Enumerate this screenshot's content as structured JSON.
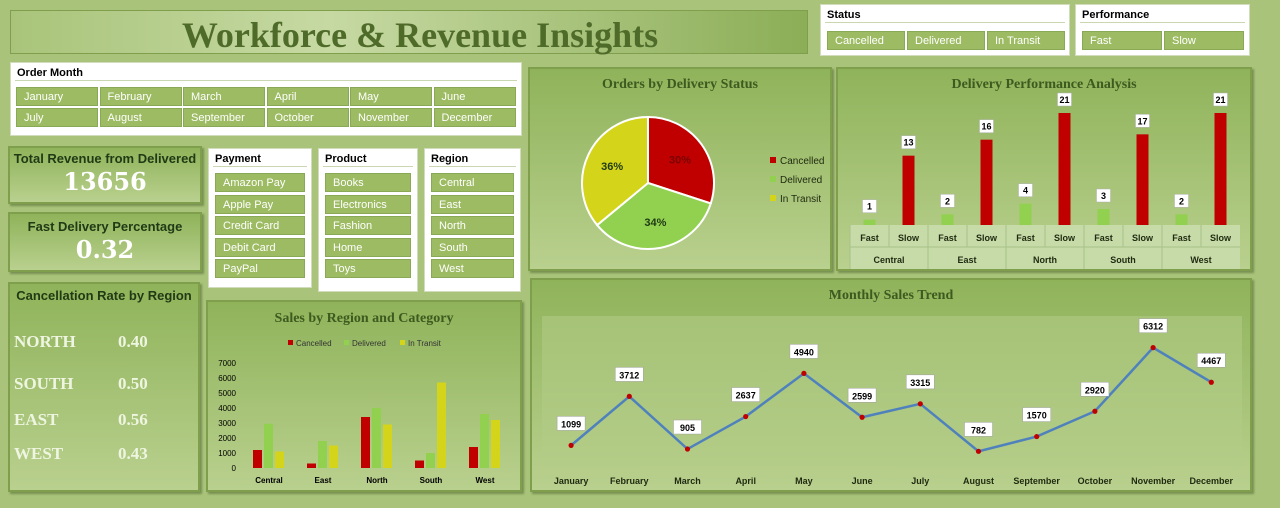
{
  "header": {
    "title": "Workforce & Revenue Insights"
  },
  "status_slicer": {
    "title": "Status",
    "items": [
      "Cancelled",
      "Delivered",
      "In Transit"
    ]
  },
  "performance_slicer": {
    "title": "Performance",
    "items": [
      "Fast",
      "Slow"
    ]
  },
  "order_month_slicer": {
    "title": "Order Month",
    "items": [
      "January",
      "February",
      "March",
      "April",
      "May",
      "June",
      "July",
      "August",
      "September",
      "October",
      "November",
      "December"
    ]
  },
  "kpis": {
    "revenue": {
      "label": "Total Revenue from Delivered",
      "value": "13656"
    },
    "fast_delivery": {
      "label": "Fast Delivery Percentage",
      "value": "0.32"
    },
    "cancellation": {
      "label": "Cancellation Rate by Region",
      "rows": [
        {
          "region": "NORTH",
          "value": "0.40"
        },
        {
          "region": "SOUTH",
          "value": "0.50"
        },
        {
          "region": "EAST",
          "value": "0.56"
        },
        {
          "region": "WEST",
          "value": "0.43"
        }
      ]
    }
  },
  "payment_slicer": {
    "title": "Payment",
    "items": [
      "Amazon Pay",
      "Apple Pay",
      "Credit Card",
      "Debit Card",
      "PayPal"
    ]
  },
  "product_slicer": {
    "title": "Product",
    "items": [
      "Books",
      "Electronics",
      "Fashion",
      "Home",
      "Toys"
    ]
  },
  "region_slicer": {
    "title": "Region",
    "items": [
      "Central",
      "East",
      "North",
      "South",
      "West"
    ]
  },
  "colors": {
    "cancelled": "#c00000",
    "delivered": "#92d050",
    "in_transit": "#d4d41a",
    "line": "#4f81bd",
    "marker": "#c00000"
  },
  "chart_data": [
    {
      "type": "pie",
      "title": "Orders by Delivery Status",
      "labels": [
        "Cancelled",
        "Delivered",
        "In Transit"
      ],
      "values": [
        30,
        34,
        36
      ],
      "value_labels": [
        "30%",
        "34%",
        "36%"
      ],
      "legend": "right"
    },
    {
      "type": "bar",
      "title": "Delivery Performance Analysis",
      "groups": [
        "Central",
        "East",
        "North",
        "South",
        "West"
      ],
      "categories": [
        "Fast",
        "Slow"
      ],
      "values": [
        [
          1,
          13
        ],
        [
          2,
          16
        ],
        [
          4,
          21
        ],
        [
          3,
          17
        ],
        [
          2,
          21
        ]
      ],
      "labels": [
        [
          "1",
          "13"
        ],
        [
          "2",
          "16"
        ],
        [
          "4",
          "21"
        ],
        [
          "3",
          "17"
        ],
        [
          "2",
          "21"
        ]
      ]
    },
    {
      "type": "bar",
      "title": "Sales by Region and Category",
      "categories": [
        "Central",
        "East",
        "North",
        "South",
        "West"
      ],
      "series": [
        {
          "name": "Cancelled",
          "values": [
            1200,
            300,
            3400,
            500,
            1400
          ]
        },
        {
          "name": "Delivered",
          "values": [
            2950,
            1800,
            4000,
            1000,
            3600
          ]
        },
        {
          "name": "In Transit",
          "values": [
            1100,
            1500,
            2900,
            5700,
            3200
          ]
        }
      ],
      "yticks": [
        "0",
        "1000",
        "2000",
        "3000",
        "4000",
        "5000",
        "6000",
        "7000"
      ],
      "ylim": [
        0,
        7000
      ],
      "legend": "top"
    },
    {
      "type": "line",
      "title": "Monthly Sales Trend",
      "categories": [
        "January",
        "February",
        "March",
        "April",
        "May",
        "June",
        "July",
        "August",
        "September",
        "October",
        "November",
        "December"
      ],
      "values": [
        1099,
        3712,
        905,
        2637,
        4940,
        2599,
        3315,
        782,
        1570,
        2920,
        6312,
        4467
      ],
      "labels": [
        "1099",
        "3712",
        "905",
        "2637",
        "4940",
        "2599",
        "3315",
        "782",
        "1570",
        "2920",
        "6312",
        "4467"
      ]
    }
  ]
}
